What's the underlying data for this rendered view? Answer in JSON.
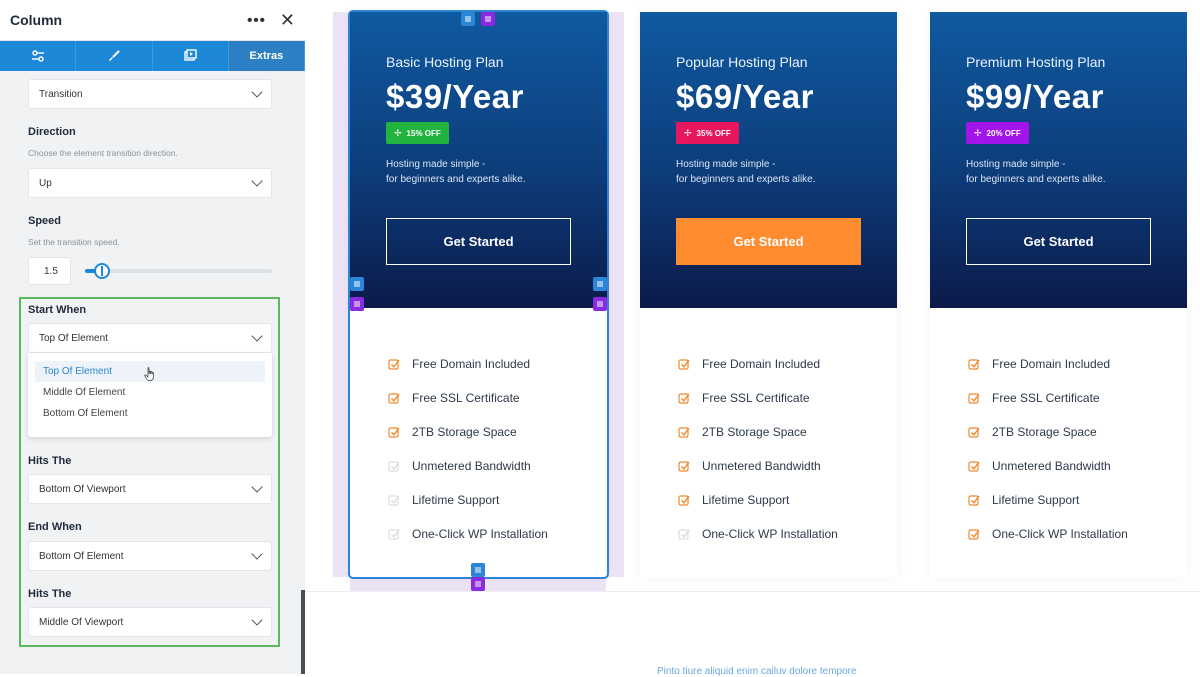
{
  "sidebar": {
    "title": "Column",
    "more_icon": "more-horizontal-icon",
    "close_icon": "close-icon",
    "tabs": [
      {
        "name": "layout-tab",
        "icon": "sliders-icon",
        "label": ""
      },
      {
        "name": "style-tab",
        "icon": "brush-icon",
        "label": ""
      },
      {
        "name": "media-tab",
        "icon": "media-icon",
        "label": ""
      },
      {
        "name": "extras-tab",
        "icon": "",
        "label": "Extras"
      }
    ],
    "effect_select": "Transition",
    "direction": {
      "label": "Direction",
      "desc": "Choose the element transition direction.",
      "value": "Up"
    },
    "speed": {
      "label": "Speed",
      "desc": "Set the transition speed.",
      "value": "1.5",
      "slider_fraction": 0.05
    },
    "start_when": {
      "label": "Start When",
      "value": "Top Of Element",
      "options": [
        "Top Of Element",
        "Middle Of Element",
        "Bottom Of Element"
      ]
    },
    "hits_the_1": {
      "label": "Hits The",
      "value": "Bottom Of Viewport"
    },
    "end_when": {
      "label": "End When",
      "value": "Bottom Of Element"
    },
    "hits_the_2": {
      "label": "Hits The",
      "value": "Middle Of Viewport"
    }
  },
  "plans": [
    {
      "name": "Basic Hosting Plan",
      "price": "$39/Year",
      "badge": "15% OFF",
      "badge_color": "#23b43f",
      "desc_1": "Hosting made simple -",
      "desc_2": "for beginners and experts alike.",
      "cta": "Get Started",
      "features": [
        {
          "label": "Free Domain Included",
          "included": true
        },
        {
          "label": "Free SSL Certificate",
          "included": true
        },
        {
          "label": "2TB Storage Space",
          "included": true
        },
        {
          "label": "Unmetered Bandwidth",
          "included": false
        },
        {
          "label": "Lifetime Support",
          "included": false
        },
        {
          "label": "One-Click WP Installation",
          "included": false
        }
      ]
    },
    {
      "name": "Popular Hosting Plan",
      "price": "$69/Year",
      "badge": "35% OFF",
      "badge_color": "#e6175c",
      "desc_1": "Hosting made simple -",
      "desc_2": "for beginners and experts alike.",
      "cta": "Get Started",
      "features": [
        {
          "label": "Free Domain Included",
          "included": true
        },
        {
          "label": "Free SSL Certificate",
          "included": true
        },
        {
          "label": "2TB Storage Space",
          "included": true
        },
        {
          "label": "Unmetered Bandwidth",
          "included": true
        },
        {
          "label": "Lifetime Support",
          "included": true
        },
        {
          "label": "One-Click WP Installation",
          "included": false
        }
      ]
    },
    {
      "name": "Premium Hosting Plan",
      "price": "$99/Year",
      "badge": "20% OFF",
      "badge_color": "#a314e8",
      "desc_1": "Hosting made simple -",
      "desc_2": "for beginners and experts alike.",
      "cta": "Get Started",
      "features": [
        {
          "label": "Free Domain Included",
          "included": true
        },
        {
          "label": "Free SSL Certificate",
          "included": true
        },
        {
          "label": "2TB Storage Space",
          "included": true
        },
        {
          "label": "Unmetered Bandwidth",
          "included": true
        },
        {
          "label": "Lifetime Support",
          "included": true
        },
        {
          "label": "One-Click WP Installation",
          "included": true
        }
      ]
    }
  ],
  "footer_text": "Pinto tiure aliquid enim cailuv dolore tempore",
  "colors": {
    "accent_blue": "#1e88d8",
    "accent_purple": "#8a2be2",
    "check_orange": "#f08a2c",
    "cta_orange": "#ff8c2f",
    "selection_green": "#5cb85c"
  }
}
